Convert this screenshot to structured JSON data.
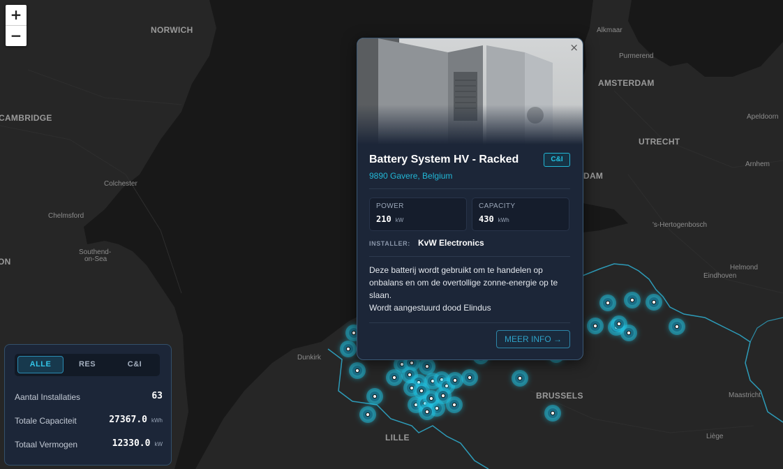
{
  "map": {
    "places": {
      "norwich": "NORWICH",
      "cambridge": "CAMBRIDGE",
      "colchester": "Colchester",
      "chelmsford": "Chelmsford",
      "southend": "Southend-\non-Sea",
      "lon": "ON",
      "alkmaar": "Alkmaar",
      "purmerend": "Purmerend",
      "amsterdam": "AMSTERDAM",
      "apeldoorn": "Apeldoorn",
      "utrecht": "UTRECHT",
      "arnhem": "Arnhem",
      "rotterdam_frag": "DAM",
      "shertogenbosch": "'s-Hertogenbosch",
      "helmond": "Helmond",
      "eindhoven": "Eindhoven",
      "dunkirk": "Dunkirk",
      "brussels": "BRUSSELS",
      "maastricht": "Maastricht",
      "lille": "LILLE",
      "liege": "Liège"
    },
    "zoom_in": "+",
    "zoom_out": "−"
  },
  "popup": {
    "close": "×",
    "title": "Battery System HV - Racked",
    "badge": "C&I",
    "location": "9890 Gavere, Belgium",
    "power_label": "POWER",
    "power_value": "210",
    "power_unit": "kW",
    "capacity_label": "CAPACITY",
    "capacity_value": "430",
    "capacity_unit": "kWh",
    "installer_label": "INSTALLER:",
    "installer_value": "KvW Electronics",
    "description_line1": "Deze batterij wordt gebruikt om te handelen op onbalans en om de overtollige zonne-energie op te slaan.",
    "description_line2": "Wordt aangestuurd dood Elindus",
    "more_button": "MEER INFO →"
  },
  "panel": {
    "tabs": [
      "ALLE",
      "RES",
      "C&I"
    ],
    "active_tab": "ALLE",
    "installations_label": "Aantal Installaties",
    "installations_value": "63",
    "capacity_label": "Totale Capaciteit",
    "capacity_value": "27367.0",
    "capacity_unit": "kWh",
    "power_label": "Totaal Vermogen",
    "power_value": "12330.0",
    "power_unit": "kW"
  },
  "colors": {
    "marker": "#22c3e3",
    "border_line": "#2fa9c9",
    "accent": "#22b7d6"
  }
}
